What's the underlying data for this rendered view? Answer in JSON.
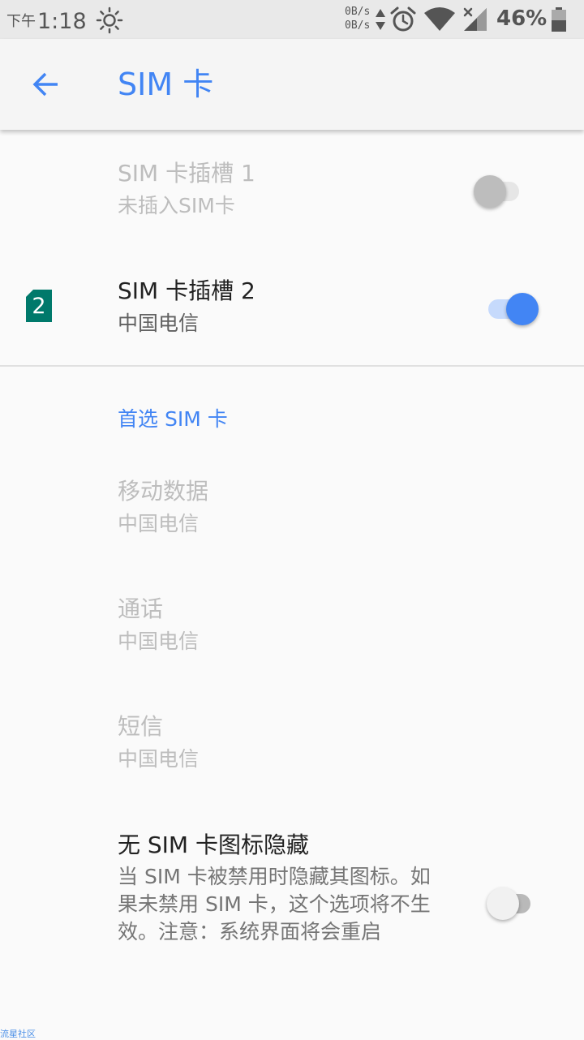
{
  "status_bar": {
    "ampm": "下午",
    "time": "1:18",
    "net_speed_up": "0B/s",
    "net_speed_down": "0B/s",
    "battery": "46%",
    "icons": [
      "brightness-icon",
      "data-arrows-icon",
      "alarm-icon",
      "wifi-icon",
      "signal-icon",
      "battery-icon"
    ]
  },
  "app_bar": {
    "title": "SIM 卡",
    "back_icon": "arrow-back-icon"
  },
  "sim_slots": [
    {
      "title": "SIM 卡插槽 1",
      "subtitle": "未插入SIM卡",
      "enabled": false,
      "toggle_on": false
    },
    {
      "title": "SIM 卡插槽 2",
      "subtitle": "中国电信",
      "badge": "2",
      "enabled": true,
      "toggle_on": true
    }
  ],
  "preferred": {
    "header": "首选 SIM 卡",
    "items": [
      {
        "title": "移动数据",
        "value": "中国电信"
      },
      {
        "title": "通话",
        "value": "中国电信"
      },
      {
        "title": "短信",
        "value": "中国电信"
      }
    ]
  },
  "hide_icon": {
    "title": "无 SIM 卡图标隐藏",
    "description": "当 SIM 卡被禁用时隐藏其图标。如果未禁用 SIM 卡，这个选项将不生效。注意：系统界面将会重启",
    "toggle_on": false
  },
  "watermark": "流星社区",
  "colors": {
    "accent": "#4285f4",
    "sim_badge": "#00796b",
    "status_bar_bg": "#e9e9e9",
    "background": "#fafafa"
  }
}
